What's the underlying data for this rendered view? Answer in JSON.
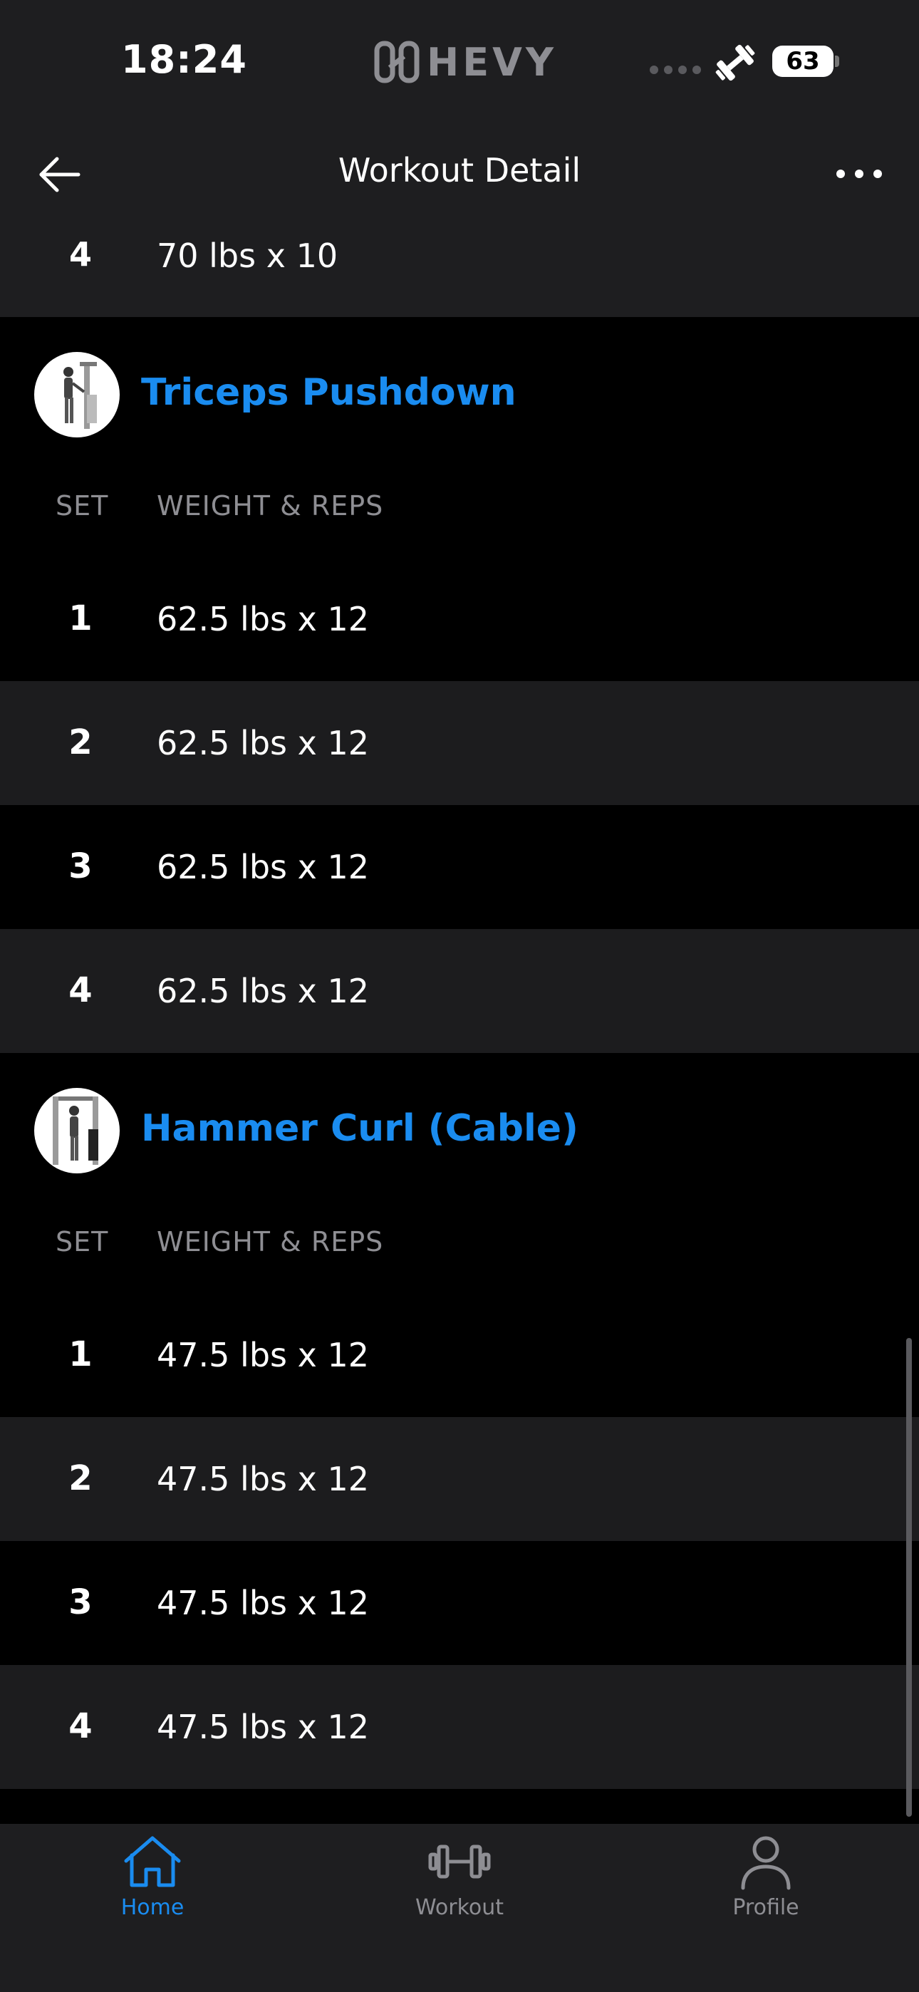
{
  "status_bar": {
    "time": "18:24",
    "brand": "HEVY",
    "battery": "63"
  },
  "header": {
    "title": "Workout Detail"
  },
  "previous_exercise_tail": {
    "set": "4",
    "value": "70 lbs x 10"
  },
  "exercises": [
    {
      "name": "Triceps Pushdown",
      "col_set": "SET",
      "col_weight": "WEIGHT & REPS",
      "sets": [
        {
          "set": "1",
          "value": "62.5 lbs x 12"
        },
        {
          "set": "2",
          "value": "62.5 lbs x 12"
        },
        {
          "set": "3",
          "value": "62.5 lbs x 12"
        },
        {
          "set": "4",
          "value": "62.5 lbs x 12"
        }
      ]
    },
    {
      "name": "Hammer Curl (Cable)",
      "col_set": "SET",
      "col_weight": "WEIGHT & REPS",
      "sets": [
        {
          "set": "1",
          "value": "47.5 lbs x 12"
        },
        {
          "set": "2",
          "value": "47.5 lbs x 12"
        },
        {
          "set": "3",
          "value": "47.5 lbs x 12"
        },
        {
          "set": "4",
          "value": "47.5 lbs x 12"
        }
      ]
    }
  ],
  "tab_bar": {
    "active_color": "#1a8cf0",
    "tabs": [
      {
        "label": "Home",
        "icon": "home-icon",
        "active": true
      },
      {
        "label": "Workout",
        "icon": "dumbbell-icon",
        "active": false
      },
      {
        "label": "Profile",
        "icon": "person-icon",
        "active": false
      }
    ]
  }
}
